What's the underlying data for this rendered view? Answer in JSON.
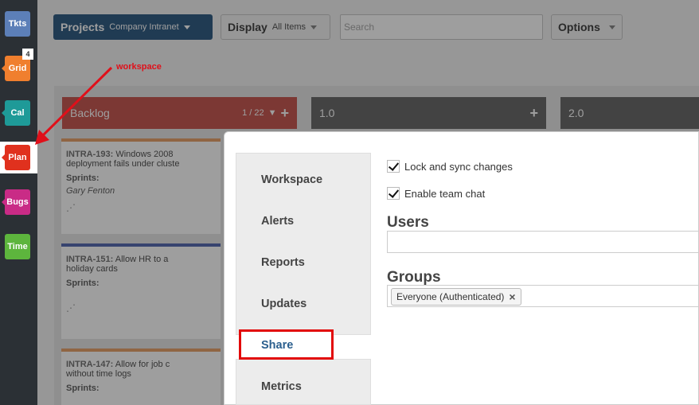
{
  "rail": {
    "items": [
      {
        "label": "Tkts",
        "color": "#5c7fb8"
      },
      {
        "label": "Grid",
        "color": "#f07f2e",
        "badge": "4"
      },
      {
        "label": "Cal",
        "color": "#1e9a98"
      },
      {
        "label": "Plan",
        "color": "#e0311e"
      },
      {
        "label": "Bugs",
        "color": "#c92b86"
      },
      {
        "label": "Time",
        "color": "#5db53d"
      }
    ]
  },
  "header": {
    "projects_label": "Projects",
    "project_name": "Company Intranet",
    "display_label": "Display",
    "display_value": "All Items",
    "search_placeholder": "Search",
    "options_label": "Options"
  },
  "annotation": {
    "text": "workspace"
  },
  "board": {
    "columns": [
      {
        "title": "Backlog",
        "count": "1 / 22",
        "color": "#c85b55"
      },
      {
        "title": "1.0",
        "color": "#6d6d6d"
      },
      {
        "title": "2.0",
        "color": "#6d6d6d"
      }
    ],
    "cards": [
      {
        "id": "INTRA-193:",
        "text": "Windows 2008",
        "text2": "deployment fails under cluste",
        "sprints_label": "Sprints:",
        "person": "Gary Fenton"
      },
      {
        "id": "INTRA-151:",
        "text": "Allow HR to a",
        "text2": "holiday cards",
        "sprints_label": "Sprints:"
      },
      {
        "id": "INTRA-147:",
        "text": "Allow for job c",
        "text2": "without time logs",
        "sprints_label": "Sprints:"
      }
    ]
  },
  "modal": {
    "nav": [
      "Workspace",
      "Alerts",
      "Reports",
      "Updates",
      "Share",
      "Metrics"
    ],
    "active": "Share",
    "lock_sync_label": "Lock and sync changes",
    "team_chat_label": "Enable team chat",
    "users_title": "Users",
    "groups_title": "Groups",
    "group_tag": "Everyone (Authenticated)"
  }
}
